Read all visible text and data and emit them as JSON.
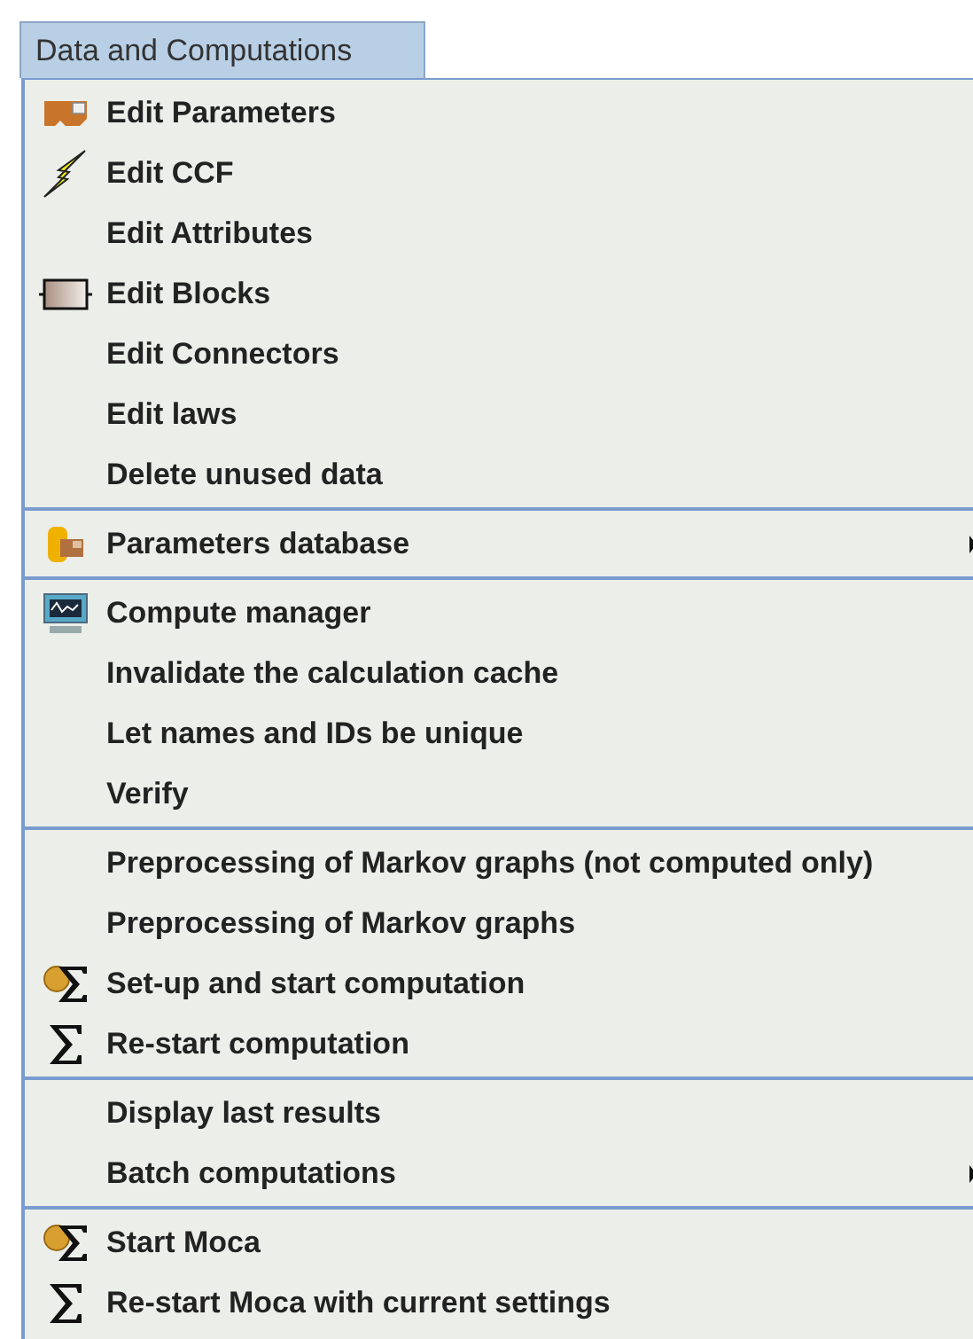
{
  "menu_title": "Data and Computations",
  "groups": [
    {
      "items": [
        {
          "label": "Edit Parameters",
          "kind": "parameters",
          "submenu": false
        },
        {
          "label": "Edit CCF",
          "kind": "lightning",
          "submenu": false
        },
        {
          "label": "Edit Attributes",
          "kind": "plain",
          "submenu": false
        },
        {
          "label": "Edit Blocks",
          "kind": "block",
          "submenu": false
        },
        {
          "label": "Edit Connectors",
          "kind": "plain",
          "submenu": false
        },
        {
          "label": "Edit laws",
          "kind": "plain",
          "submenu": false
        },
        {
          "label": "Delete unused data",
          "kind": "plain",
          "submenu": false
        }
      ]
    },
    {
      "items": [
        {
          "label": "Parameters database",
          "kind": "database",
          "submenu": true
        }
      ]
    },
    {
      "items": [
        {
          "label": "Compute manager",
          "kind": "monitor",
          "submenu": false
        },
        {
          "label": "Invalidate the calculation cache",
          "kind": "plain",
          "submenu": false
        },
        {
          "label": "Let names and IDs be unique",
          "kind": "plain",
          "submenu": false
        },
        {
          "label": "Verify",
          "kind": "plain",
          "submenu": false
        }
      ]
    },
    {
      "items": [
        {
          "label": "Preprocessing of Markov graphs (not computed only)",
          "kind": "plain",
          "submenu": false
        },
        {
          "label": "Preprocessing of Markov graphs",
          "kind": "plain",
          "submenu": false
        },
        {
          "label": "Set-up and start computation",
          "kind": "sigma-gear",
          "submenu": false
        },
        {
          "label": "Re-start computation",
          "kind": "sigma",
          "submenu": false
        }
      ]
    },
    {
      "items": [
        {
          "label": "Display last results",
          "kind": "plain",
          "submenu": false
        },
        {
          "label": "Batch computations",
          "kind": "plain",
          "submenu": true
        }
      ]
    },
    {
      "items": [
        {
          "label": "Start Moca",
          "kind": "sigma-gear",
          "submenu": false
        },
        {
          "label": "Re-start Moca with current settings",
          "kind": "sigma",
          "submenu": false
        }
      ]
    }
  ]
}
